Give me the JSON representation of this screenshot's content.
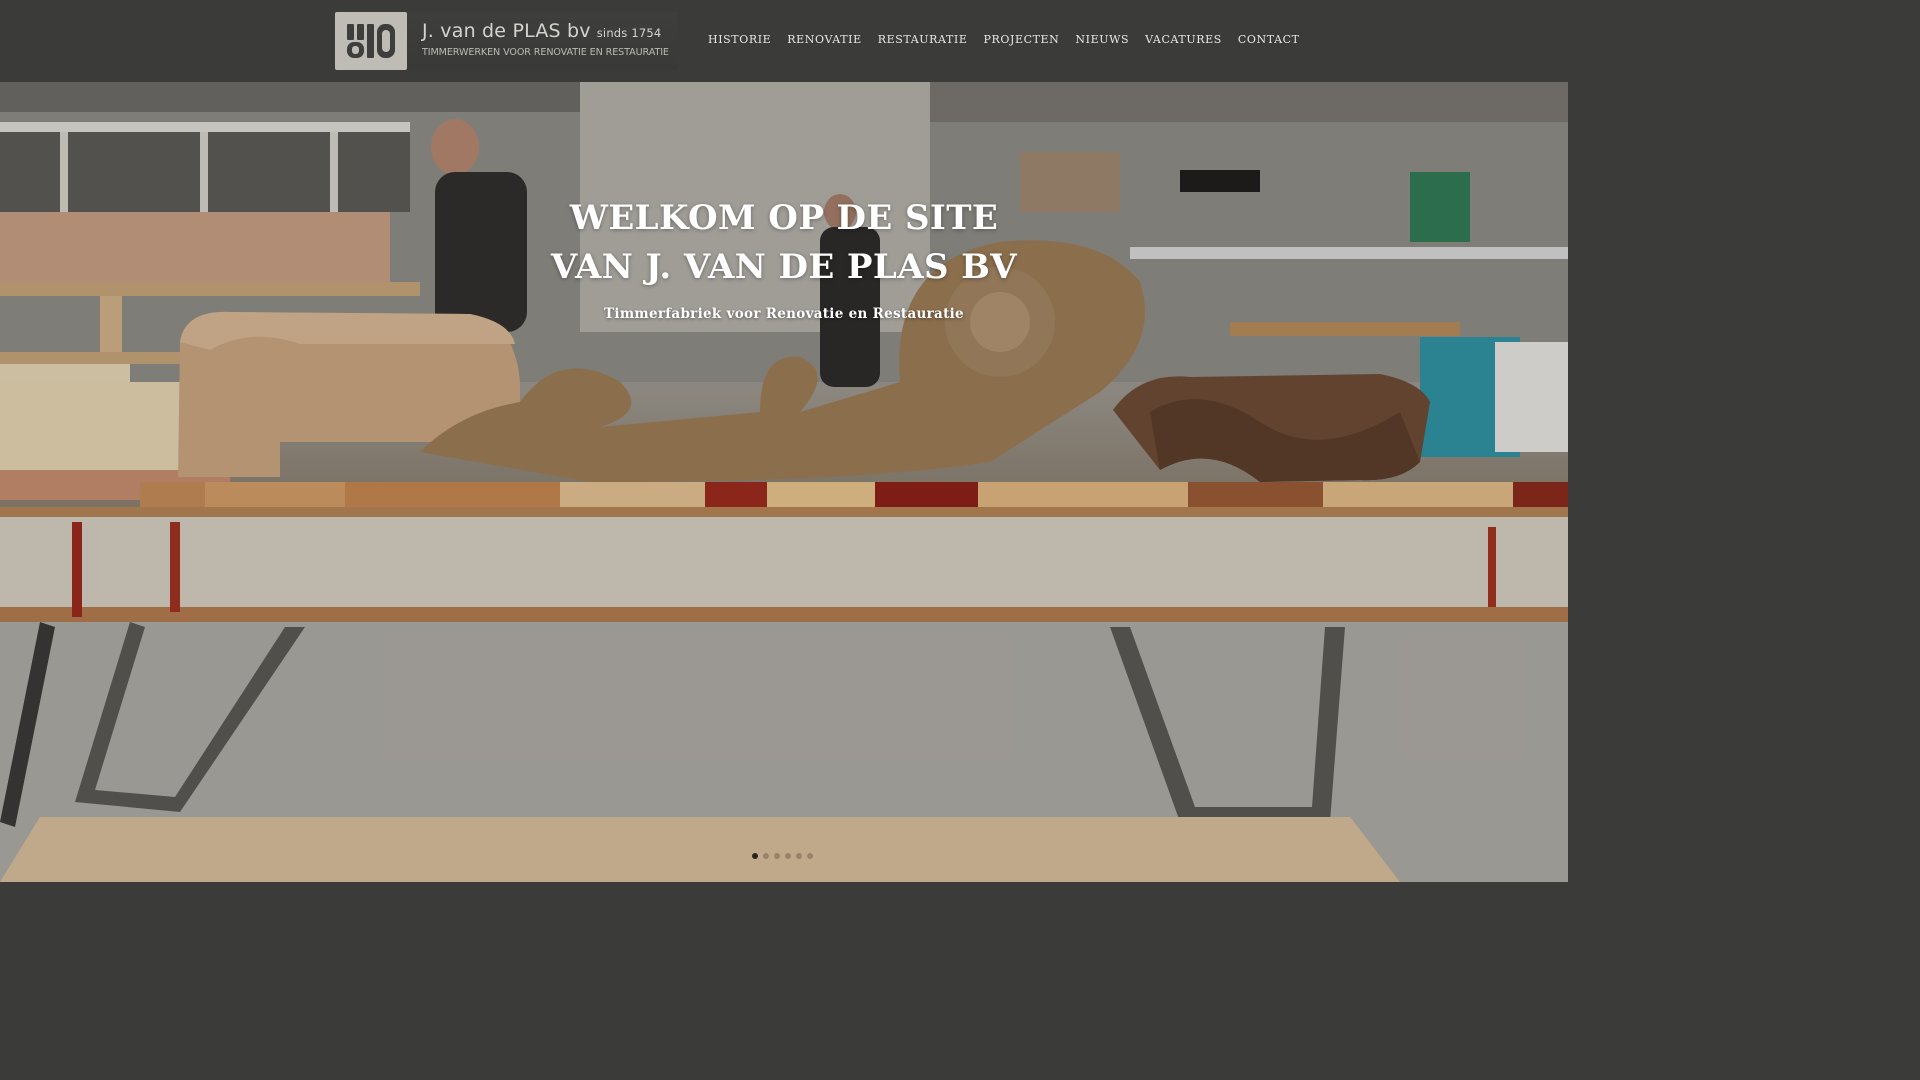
{
  "brand": {
    "name": "J. van de PLAS bv",
    "since": "sinds 1754",
    "tagline": "TIMMERWERKEN VOOR RENOVATIE EN RESTAURATIE",
    "mark_text": "vdp"
  },
  "nav": {
    "items": [
      {
        "label": "HISTORIE"
      },
      {
        "label": "RENOVATIE"
      },
      {
        "label": "RESTAURATIE"
      },
      {
        "label": "PROJECTEN"
      },
      {
        "label": "NIEUWS"
      },
      {
        "label": "VACATURES"
      },
      {
        "label": "CONTACT"
      }
    ]
  },
  "hero": {
    "title_line1": "WELKOM OP DE SITE",
    "title_line2": "VAN J. VAN DE PLAS BV",
    "subtitle": "Timmerfabriek voor Renovatie en Restauratie",
    "slide_count": 6,
    "active_slide": 1
  },
  "colors": {
    "header_bg": "#3b3c3a",
    "nav_text": "#e8e6e2",
    "hero_text": "#ffffff"
  }
}
